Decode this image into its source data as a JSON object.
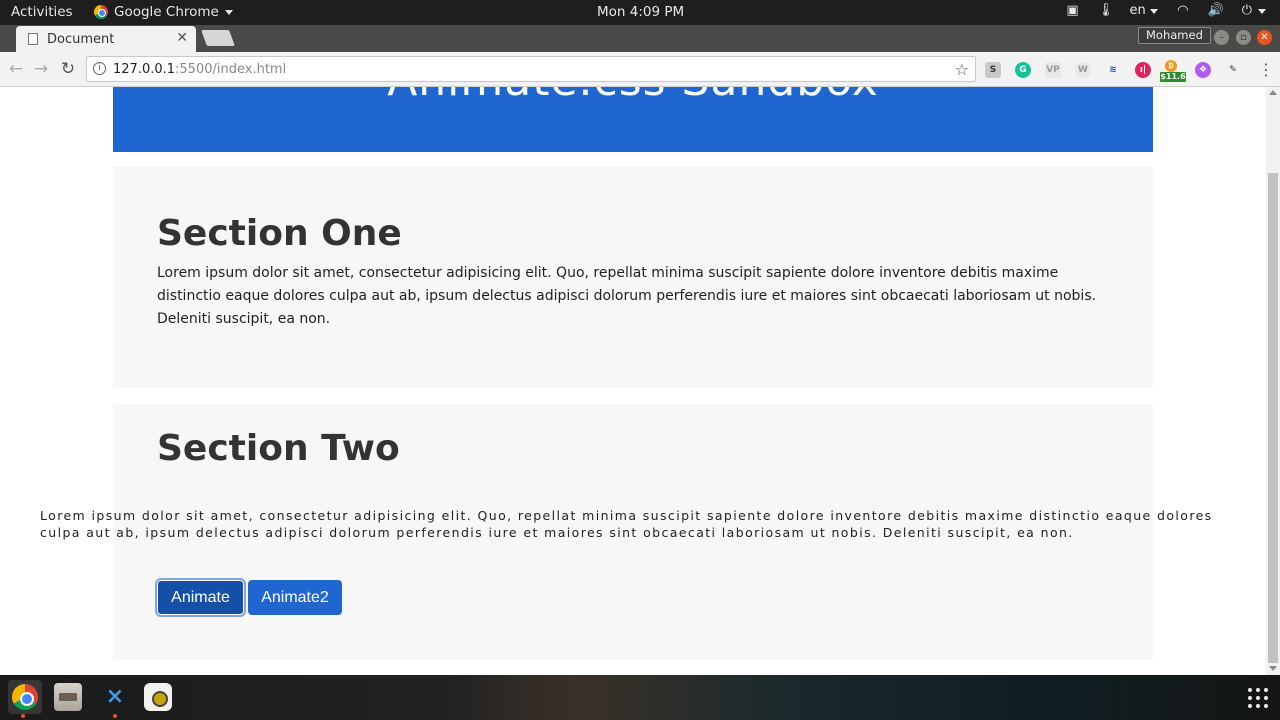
{
  "topbar": {
    "activities": "Activities",
    "app_name": "Google Chrome",
    "clock": "Mon  4:09 PM",
    "language": "en"
  },
  "browser": {
    "tab_title": "Document",
    "profile_name": "Mohamed",
    "url_host": "127.0.0.1",
    "url_rest": ":5500/index.html",
    "extension_badge": "$11.6"
  },
  "page": {
    "header_title": "Animate.css Sandbox",
    "section_one": {
      "heading": "Section One",
      "body": "Lorem ipsum dolor sit amet, consectetur adipisicing elit. Quo, repellat minima suscipit sapiente dolore inventore debitis maxime distinctio eaque dolores culpa aut ab, ipsum delectus adipisci dolorum perferendis iure et maiores sint obcaecati laboriosam ut nobis. Deleniti suscipit, ea non."
    },
    "section_two": {
      "heading": "Section Two",
      "body": "Lorem ipsum dolor sit amet, consectetur adipisicing elit. Quo, repellat minima suscipit sapiente dolore inventore debitis maxime distinctio eaque dolores culpa aut ab, ipsum delectus adipisci dolorum perferendis iure et maiores sint obcaecati laboriosam ut nobis. Deleniti suscipit, ea non.",
      "button_animate": "Animate",
      "button_animate2": "Animate2"
    }
  },
  "colors": {
    "header_blue": "#1f66d1",
    "section_bg": "#f7f7f7",
    "button_blue": "#1f66d1",
    "button_active": "#1550a8"
  }
}
